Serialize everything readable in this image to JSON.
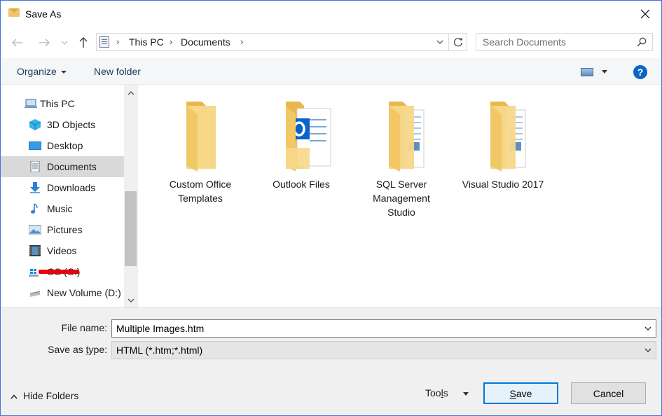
{
  "window": {
    "title": "Save As"
  },
  "address": {
    "crumbs": [
      "This PC",
      "Documents"
    ],
    "search_placeholder": "Search Documents"
  },
  "commandbar": {
    "organize": "Organize",
    "new_folder": "New folder",
    "help": "?"
  },
  "nav": {
    "top": "This PC",
    "items": [
      {
        "label": "3D Objects",
        "icon": "3d-objects-icon"
      },
      {
        "label": "Desktop",
        "icon": "desktop-icon"
      },
      {
        "label": "Documents",
        "icon": "documents-icon",
        "selected": true
      },
      {
        "label": "Downloads",
        "icon": "downloads-icon"
      },
      {
        "label": "Music",
        "icon": "music-icon"
      },
      {
        "label": "Pictures",
        "icon": "pictures-icon"
      },
      {
        "label": "Videos",
        "icon": "videos-icon"
      },
      {
        "label": "OS (C:)",
        "icon": "os-drive-icon",
        "redacted": true
      },
      {
        "label": "New Volume (D:)",
        "icon": "drive-icon"
      }
    ]
  },
  "folders": [
    {
      "label": "Custom Office Templates",
      "icon": "folder-icon"
    },
    {
      "label": "Outlook Files",
      "icon": "outlook-folder-icon"
    },
    {
      "label": "SQL Server Management Studio",
      "icon": "folder-docs-icon"
    },
    {
      "label": "Visual Studio 2017",
      "icon": "folder-docs-icon"
    }
  ],
  "form": {
    "filename_label": "File name:",
    "filename_value": "Multiple Images.htm",
    "type_label_pre": "Save as ",
    "type_label_ul": "t",
    "type_label_post": "ype:",
    "type_value": "HTML (*.htm;*.html)"
  },
  "footer": {
    "hide_folders": "Hide Folders",
    "tools_pre": "Too",
    "tools_ul": "l",
    "tools_post": "s",
    "save_ul": "S",
    "save_post": "ave",
    "cancel": "Cancel"
  },
  "colors": {
    "accent": "#0078d7",
    "folder": "#f5d27a",
    "selected": "#d9d9d9",
    "redaction": "#e8000b"
  }
}
